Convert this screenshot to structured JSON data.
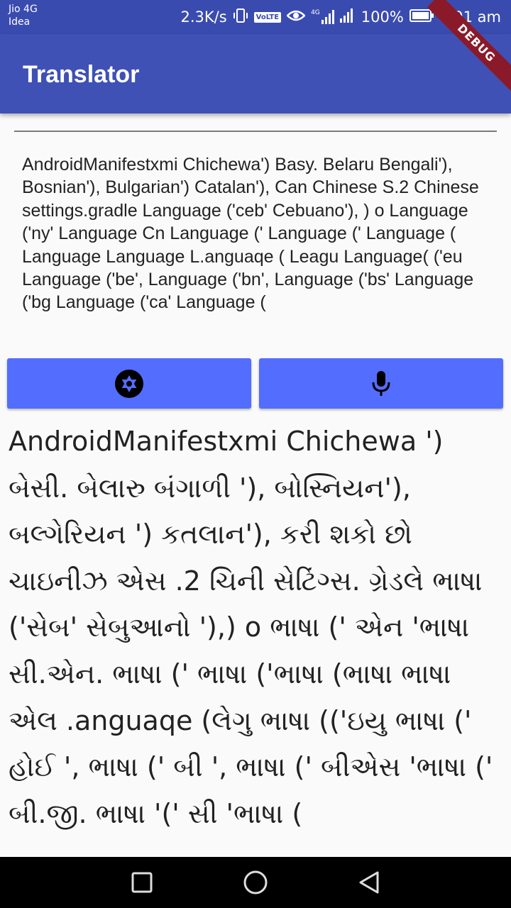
{
  "status_bar": {
    "carrier_line1": "Jio 4G",
    "carrier_line2": "Idea",
    "network_speed": "2.3K/s",
    "volte": "VoLTE",
    "network_type": "4G",
    "battery": "100%",
    "time": "8:01 am"
  },
  "app_bar": {
    "title": "Translator",
    "debug_banner": "DEBUG"
  },
  "input_text": "AndroidManifestxmi Chichewa') Basy. Belaru Bengali'), Bosnian'), Bulgarian') Catalan'), Can Chinese S.2 Chinese settings.gradle Language ('ceb' Cebuano'), ) o Language ('ny' Language Cn Language (' Language (' Language ( Language Language L.anguaqe ( Leagu Language( ('eu Language ('be', Language ('bn', Language ('bs' Language ('bg Language ('ca' Language (",
  "buttons": {
    "camera_icon": "camera-shutter-icon",
    "mic_icon": "microphone-icon",
    "color": "#536dfe"
  },
  "output_text": "AndroidManifestxmi Chichewa ') બેસી. બેલારુ બંગાળી '), બોસ્નિયન'), બલ્ગેરિયન ') કતલાન'), કરી શકો છો ચાઇનીઝ એસ .2 ચિની સેટિંગ્સ. ગ્રેડલે ભાષા ('સેબ' સેબુઆનો '),) o ભાષા (' એન 'ભાષા સી.એન. ભાષા (' ભાષા ('ભાષા (ભાષા ભાષા એલ .anguaqe (લેગુ ભાષા (('ઇયુ ભાષા (' હોઈ ', ભાષા (' બી ', ભાષા (' બીએસ 'ભાષા (' બી.જી. ભાષા '(' સી 'ભાષા (",
  "nav_bar": {
    "recents_icon": "square-icon",
    "home_icon": "circle-icon",
    "back_icon": "triangle-back-icon"
  },
  "colors": {
    "app_bar": "#3f51b5",
    "status_bar": "#3a4bb0",
    "button": "#536dfe"
  }
}
